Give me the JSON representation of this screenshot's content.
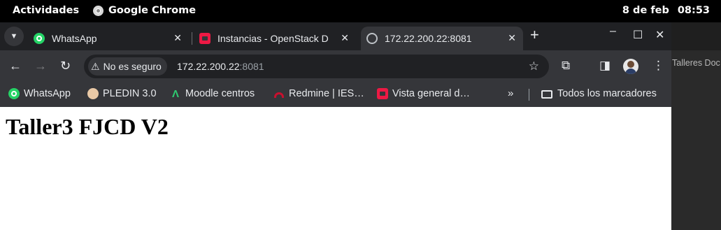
{
  "system_bar": {
    "activities": "Actividades",
    "app_name": "Google Chrome",
    "date": "8 de feb",
    "time": "08:53"
  },
  "tabs": [
    {
      "title": "WhatsApp",
      "favicon": "whatsapp-icon",
      "active": false
    },
    {
      "title": "Instancias - OpenStack D",
      "favicon": "openstack-icon",
      "active": false
    },
    {
      "title": "172.22.200.22:8081",
      "favicon": "globe-icon",
      "active": true
    }
  ],
  "omnibox": {
    "security_label": "No es seguro",
    "url_host": "172.22.200.22",
    "url_port": ":8081"
  },
  "bookmarks": [
    {
      "label": "WhatsApp",
      "icon": "whatsapp-icon"
    },
    {
      "label": "PLEDIN 3.0",
      "icon": "pledin-icon"
    },
    {
      "label": "Moodle centros",
      "icon": "moodle-icon"
    },
    {
      "label": "Redmine | IES…",
      "icon": "redmine-icon"
    },
    {
      "label": "Vista general d…",
      "icon": "openstack-icon"
    }
  ],
  "bookmarks_overflow": "»",
  "all_bookmarks": "Todos los marcadores",
  "page": {
    "heading": "Taller3 FJCD V2"
  },
  "background_window": {
    "text": "Talleres Doc"
  },
  "colors": {
    "whatsapp": "#25d366",
    "openstack": "#ed1944",
    "toolbar": "#35363a",
    "tabstrip": "#202124"
  }
}
